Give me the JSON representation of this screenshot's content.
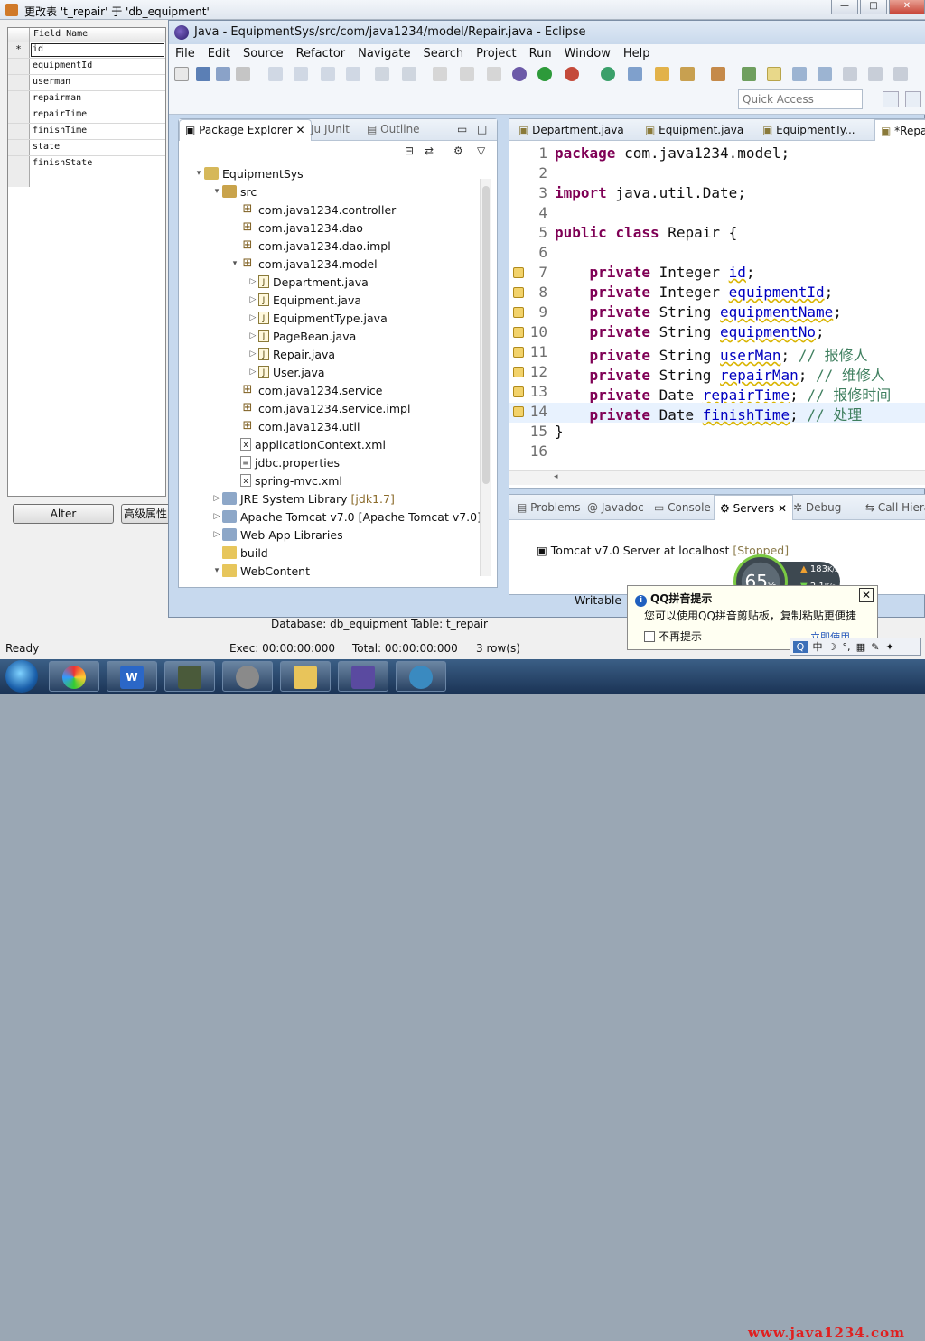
{
  "db_window": {
    "title": "更改表 't_repair' 于 'db_equipment'",
    "grid_header": "Field Name",
    "current_row_marker": "*",
    "fields": [
      "id",
      "equipmentId",
      "userman",
      "repairman",
      "repairTime",
      "finishTime",
      "state",
      "finishState"
    ],
    "alter_button": "Alter",
    "advanced_button": "高级属性",
    "database_info": "Database: db_equipment Table: t_repair",
    "status": {
      "ready": "Ready",
      "exec": "Exec: 00:00:00:000",
      "total": "Total: 00:00:00:000",
      "rows": "3 row(s)"
    }
  },
  "eclipse": {
    "title": "Java - EquipmentSys/src/com/java1234/model/Repair.java - Eclipse",
    "menu": [
      "File",
      "Edit",
      "Source",
      "Refactor",
      "Navigate",
      "Search",
      "Project",
      "Run",
      "Window",
      "Help"
    ],
    "quick_access_placeholder": "Quick Access",
    "explorer_tabs": {
      "package_explorer": "Package Explorer",
      "junit": "JUnit",
      "outline": "Outline"
    },
    "tree": [
      {
        "label": "EquipmentSys",
        "icon": "project-icon",
        "depth": 0,
        "arrow": "▾"
      },
      {
        "label": "src",
        "icon": "source-folder-icon",
        "depth": 1,
        "arrow": "▾"
      },
      {
        "label": "com.java1234.controller",
        "icon": "package-icon",
        "depth": 2,
        "arrow": ""
      },
      {
        "label": "com.java1234.dao",
        "icon": "package-icon",
        "depth": 2,
        "arrow": ""
      },
      {
        "label": "com.java1234.dao.impl",
        "icon": "package-icon",
        "depth": 2,
        "arrow": ""
      },
      {
        "label": "com.java1234.model",
        "icon": "package-icon",
        "depth": 2,
        "arrow": "▾"
      },
      {
        "label": "Department.java",
        "icon": "java-file-icon",
        "depth": 3,
        "arrow": "▷"
      },
      {
        "label": "Equipment.java",
        "icon": "java-file-icon",
        "depth": 3,
        "arrow": "▷"
      },
      {
        "label": "EquipmentType.java",
        "icon": "java-file-icon",
        "depth": 3,
        "arrow": "▷"
      },
      {
        "label": "PageBean.java",
        "icon": "java-file-icon",
        "depth": 3,
        "arrow": "▷"
      },
      {
        "label": "Repair.java",
        "icon": "java-file-icon",
        "depth": 3,
        "arrow": "▷"
      },
      {
        "label": "User.java",
        "icon": "java-file-icon",
        "depth": 3,
        "arrow": "▷"
      },
      {
        "label": "com.java1234.service",
        "icon": "package-icon",
        "depth": 2,
        "arrow": ""
      },
      {
        "label": "com.java1234.service.impl",
        "icon": "package-icon",
        "depth": 2,
        "arrow": ""
      },
      {
        "label": "com.java1234.util",
        "icon": "package-icon",
        "depth": 2,
        "arrow": ""
      },
      {
        "label": "applicationContext.xml",
        "icon": "xml-file-icon",
        "depth": 2,
        "arrow": ""
      },
      {
        "label": "jdbc.properties",
        "icon": "properties-file-icon",
        "depth": 2,
        "arrow": ""
      },
      {
        "label": "spring-mvc.xml",
        "icon": "xml-file-icon",
        "depth": 2,
        "arrow": ""
      },
      {
        "label": "JRE System Library",
        "suffix": "[jdk1.7]",
        "icon": "library-icon",
        "depth": 1,
        "arrow": "▷"
      },
      {
        "label": "Apache Tomcat v7.0 [Apache Tomcat v7.0]",
        "icon": "library-icon",
        "depth": 1,
        "arrow": "▷"
      },
      {
        "label": "Web App Libraries",
        "icon": "library-icon",
        "depth": 1,
        "arrow": "▷"
      },
      {
        "label": "build",
        "icon": "folder-icon",
        "depth": 1,
        "arrow": ""
      },
      {
        "label": "WebContent",
        "icon": "folder-icon",
        "depth": 1,
        "arrow": "▾"
      }
    ],
    "editor_tabs": [
      "Department.java",
      "Equipment.java",
      "EquipmentTy...",
      "*Repa"
    ],
    "code_lines": [
      {
        "n": "1",
        "tokens": [
          [
            "kw",
            "package"
          ],
          [
            "",
            " com.java1234.model;"
          ]
        ]
      },
      {
        "n": "2",
        "tokens": []
      },
      {
        "n": "3",
        "tokens": [
          [
            "kw",
            "import"
          ],
          [
            "",
            " java.util.Date;"
          ]
        ]
      },
      {
        "n": "4",
        "tokens": []
      },
      {
        "n": "5",
        "tokens": [
          [
            "kw",
            "public"
          ],
          [
            "",
            " "
          ],
          [
            "kw",
            "class"
          ],
          [
            "",
            " Repair {"
          ]
        ]
      },
      {
        "n": "6",
        "tokens": []
      },
      {
        "n": "7",
        "mark": true,
        "tokens": [
          [
            "",
            "    "
          ],
          [
            "kw",
            "private"
          ],
          [
            "",
            " Integer "
          ],
          [
            "fld",
            "id"
          ],
          [
            "",
            ";"
          ]
        ]
      },
      {
        "n": "8",
        "mark": true,
        "tokens": [
          [
            "",
            "    "
          ],
          [
            "kw",
            "private"
          ],
          [
            "",
            " Integer "
          ],
          [
            "fld",
            "equipmentId"
          ],
          [
            "",
            ";"
          ]
        ]
      },
      {
        "n": "9",
        "mark": true,
        "tokens": [
          [
            "",
            "    "
          ],
          [
            "kw",
            "private"
          ],
          [
            "",
            " String "
          ],
          [
            "fld",
            "equipmentName"
          ],
          [
            "",
            ";"
          ]
        ]
      },
      {
        "n": "10",
        "mark": true,
        "tokens": [
          [
            "",
            "    "
          ],
          [
            "kw",
            "private"
          ],
          [
            "",
            " String "
          ],
          [
            "fld",
            "equipmentNo"
          ],
          [
            "",
            ";"
          ]
        ]
      },
      {
        "n": "11",
        "mark": true,
        "tokens": [
          [
            "",
            "    "
          ],
          [
            "kw",
            "private"
          ],
          [
            "",
            " String "
          ],
          [
            "fld",
            "userMan"
          ],
          [
            "",
            "; "
          ],
          [
            "cm",
            "// 报修人"
          ]
        ]
      },
      {
        "n": "12",
        "mark": true,
        "tokens": [
          [
            "",
            "    "
          ],
          [
            "kw",
            "private"
          ],
          [
            "",
            " String "
          ],
          [
            "fld",
            "repairMan"
          ],
          [
            "",
            "; "
          ],
          [
            "cm",
            "// 维修人"
          ]
        ]
      },
      {
        "n": "13",
        "mark": true,
        "tokens": [
          [
            "",
            "    "
          ],
          [
            "kw",
            "private"
          ],
          [
            "",
            " Date "
          ],
          [
            "fld",
            "repairTime"
          ],
          [
            "",
            "; "
          ],
          [
            "cm",
            "// 报修时间"
          ]
        ]
      },
      {
        "n": "14",
        "mark": true,
        "current": true,
        "tokens": [
          [
            "",
            "    "
          ],
          [
            "kw",
            "private"
          ],
          [
            "",
            " Date "
          ],
          [
            "fld",
            "finishTime"
          ],
          [
            "",
            "; "
          ],
          [
            "cm",
            "// 处理"
          ]
        ]
      },
      {
        "n": "15",
        "tokens": [
          [
            "",
            "}"
          ]
        ]
      },
      {
        "n": "16",
        "tokens": []
      }
    ],
    "bottom_tabs": [
      "Problems",
      "Javadoc",
      "Console",
      "Servers",
      "Debug",
      "Call Hierarc"
    ],
    "server_entry": {
      "name": "Tomcat v7.0 Server at localhost",
      "state": "[Stopped]"
    },
    "status_writable": "Writable"
  },
  "net_gauge": {
    "percent": "65",
    "percent_unit": "%",
    "upload": "183",
    "download": "2.1",
    "unit": "K/s"
  },
  "qq_popup": {
    "title": "QQ拼音提示",
    "message": "您可以使用QQ拼音剪贴板，复制粘贴更便捷",
    "checkbox": "不再提示",
    "more": "立即使用"
  },
  "ime_toolbar": [
    "中",
    "☽",
    "°,",
    "▦",
    "✎",
    "✦"
  ],
  "watermark": "www.java1234.com"
}
